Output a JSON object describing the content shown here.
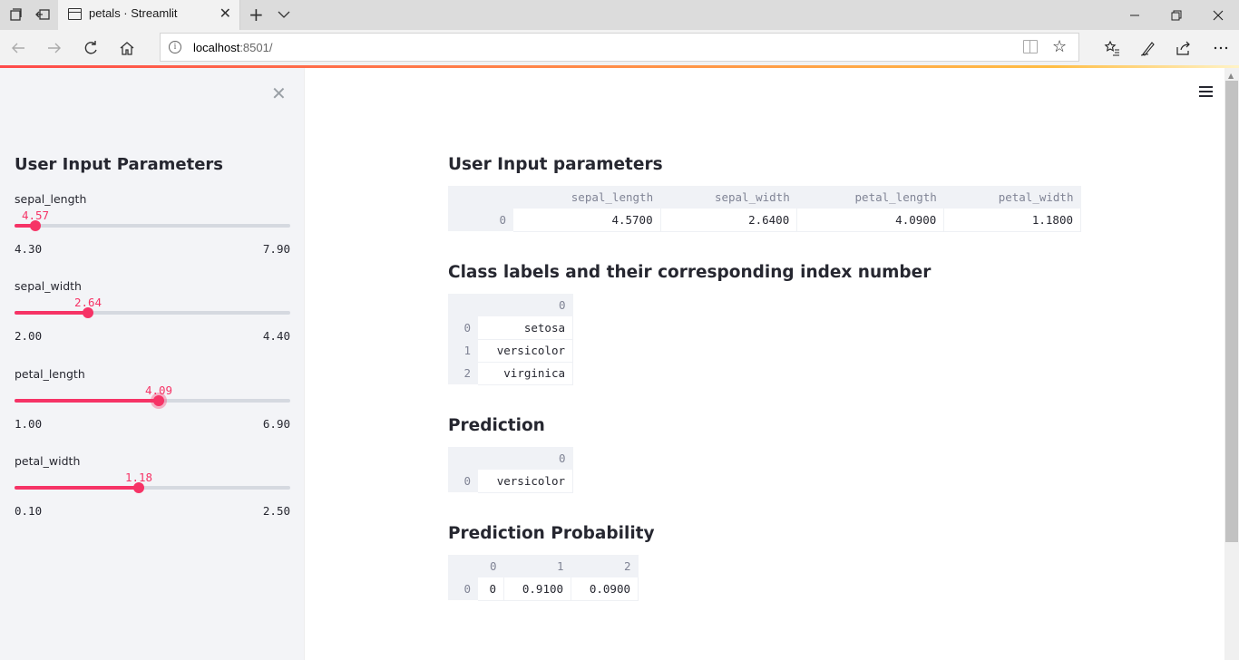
{
  "browser": {
    "tab_title": "petals · Streamlit",
    "url_host": "localhost",
    "url_port": ":8501/",
    "accent_color": "#f63366"
  },
  "sidebar": {
    "title": "User Input Parameters",
    "sliders": [
      {
        "label": "sepal_length",
        "value": "4.57",
        "min": "4.30",
        "max": "7.90",
        "fraction": 0.075
      },
      {
        "label": "sepal_width",
        "value": "2.64",
        "min": "2.00",
        "max": "4.40",
        "fraction": 0.267
      },
      {
        "label": "petal_length",
        "value": "4.09",
        "min": "1.00",
        "max": "6.90",
        "fraction": 0.524
      },
      {
        "label": "petal_width",
        "value": "1.18",
        "min": "0.10",
        "max": "2.50",
        "fraction": 0.45
      }
    ]
  },
  "main": {
    "sections": [
      {
        "heading": "User Input parameters"
      },
      {
        "heading": "Class labels and their corresponding index number"
      },
      {
        "heading": "Prediction"
      },
      {
        "heading": "Prediction Probability"
      }
    ],
    "input_table": {
      "columns": [
        "sepal_length",
        "sepal_width",
        "petal_length",
        "petal_width"
      ],
      "rows": [
        {
          "index": "0",
          "cells": [
            "4.5700",
            "2.6400",
            "4.0900",
            "1.1800"
          ]
        }
      ]
    },
    "labels_table": {
      "columns": [
        "0"
      ],
      "rows": [
        {
          "index": "0",
          "cells": [
            "setosa"
          ]
        },
        {
          "index": "1",
          "cells": [
            "versicolor"
          ]
        },
        {
          "index": "2",
          "cells": [
            "virginica"
          ]
        }
      ]
    },
    "prediction_table": {
      "columns": [
        "0"
      ],
      "rows": [
        {
          "index": "0",
          "cells": [
            "versicolor"
          ]
        }
      ]
    },
    "probability_table": {
      "columns": [
        "0",
        "1",
        "2"
      ],
      "rows": [
        {
          "index": "0",
          "cells": [
            "0",
            "0.9100",
            "0.0900"
          ]
        }
      ]
    }
  }
}
